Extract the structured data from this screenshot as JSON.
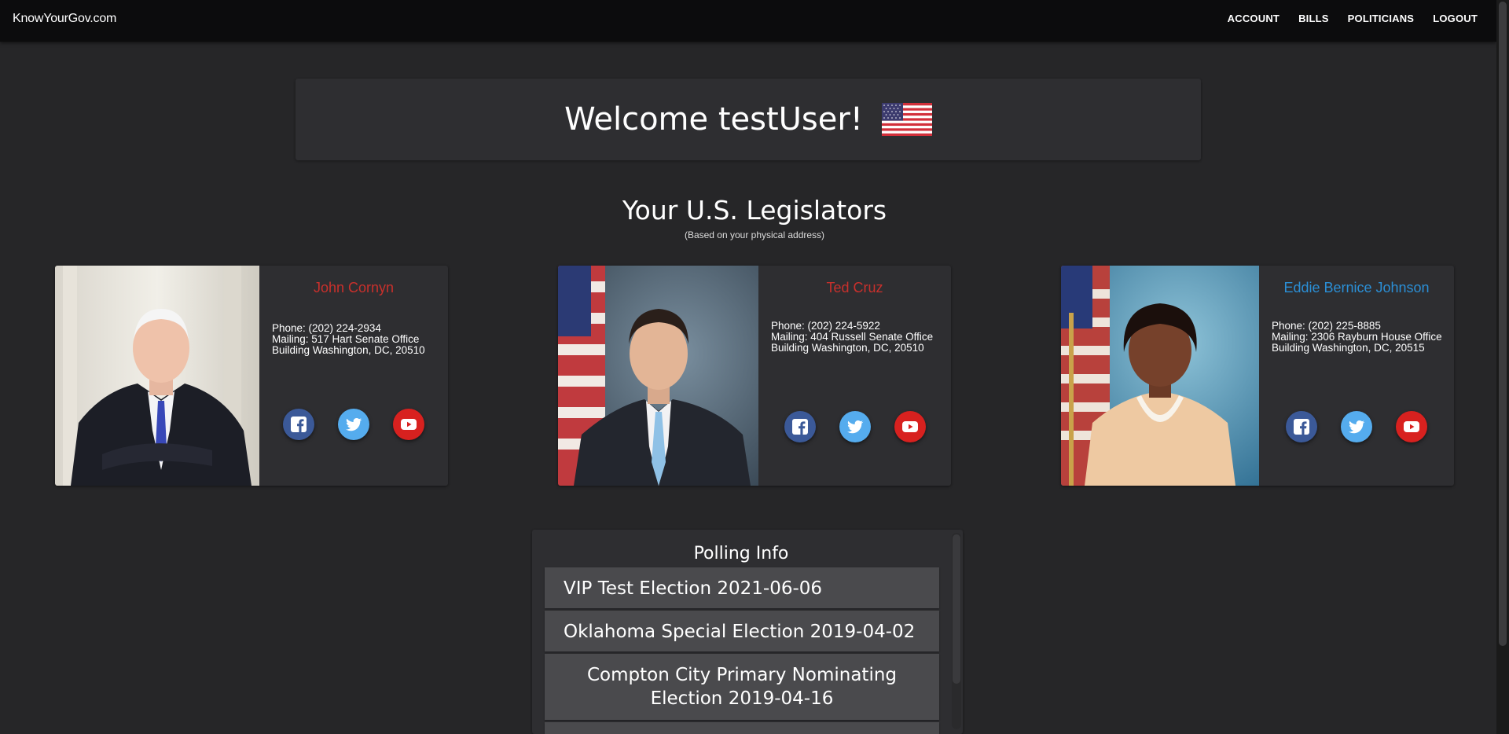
{
  "nav": {
    "brand": "KnowYourGov.com",
    "links": [
      "ACCOUNT",
      "BILLS",
      "POLITICIANS",
      "LOGOUT"
    ]
  },
  "welcome": {
    "text": "Welcome testUser!"
  },
  "legislators_section": {
    "title": "Your U.S. Legislators",
    "subtitle": "(Based on your physical address)"
  },
  "legislators": [
    {
      "name": "John Cornyn",
      "name_color": "#c9302c",
      "phone": "Phone: (202) 224-2934",
      "mailing": "Mailing: 517 Hart Senate Office Building Washington, DC, 20510"
    },
    {
      "name": "Ted Cruz",
      "name_color": "#c9302c",
      "phone": "Phone: (202) 224-5922",
      "mailing": "Mailing: 404 Russell Senate Office Building Washington, DC, 20510"
    },
    {
      "name": "Eddie Bernice Johnson",
      "name_color": "#2b8fd6",
      "phone": "Phone: (202) 225-8885",
      "mailing": "Mailing: 2306 Rayburn House Office Building Washington, DC, 20515"
    }
  ],
  "polling": {
    "title": "Polling Info",
    "elections": [
      "VIP Test Election 2021-06-06",
      "Oklahoma Special Election 2019-04-02",
      "Compton City Primary Nominating Election 2019-04-16"
    ]
  },
  "icons": {
    "social": [
      "facebook-icon",
      "twitter-icon",
      "youtube-icon"
    ],
    "flag": "us-flag-icon"
  },
  "colors": {
    "background": "#262628",
    "navbar": "#0c0c0d",
    "panel": "#2e2e31",
    "republican": "#c9302c",
    "democrat": "#2b8fd6",
    "facebook": "#3b5998",
    "twitter": "#55acee",
    "youtube": "#d8211f"
  }
}
